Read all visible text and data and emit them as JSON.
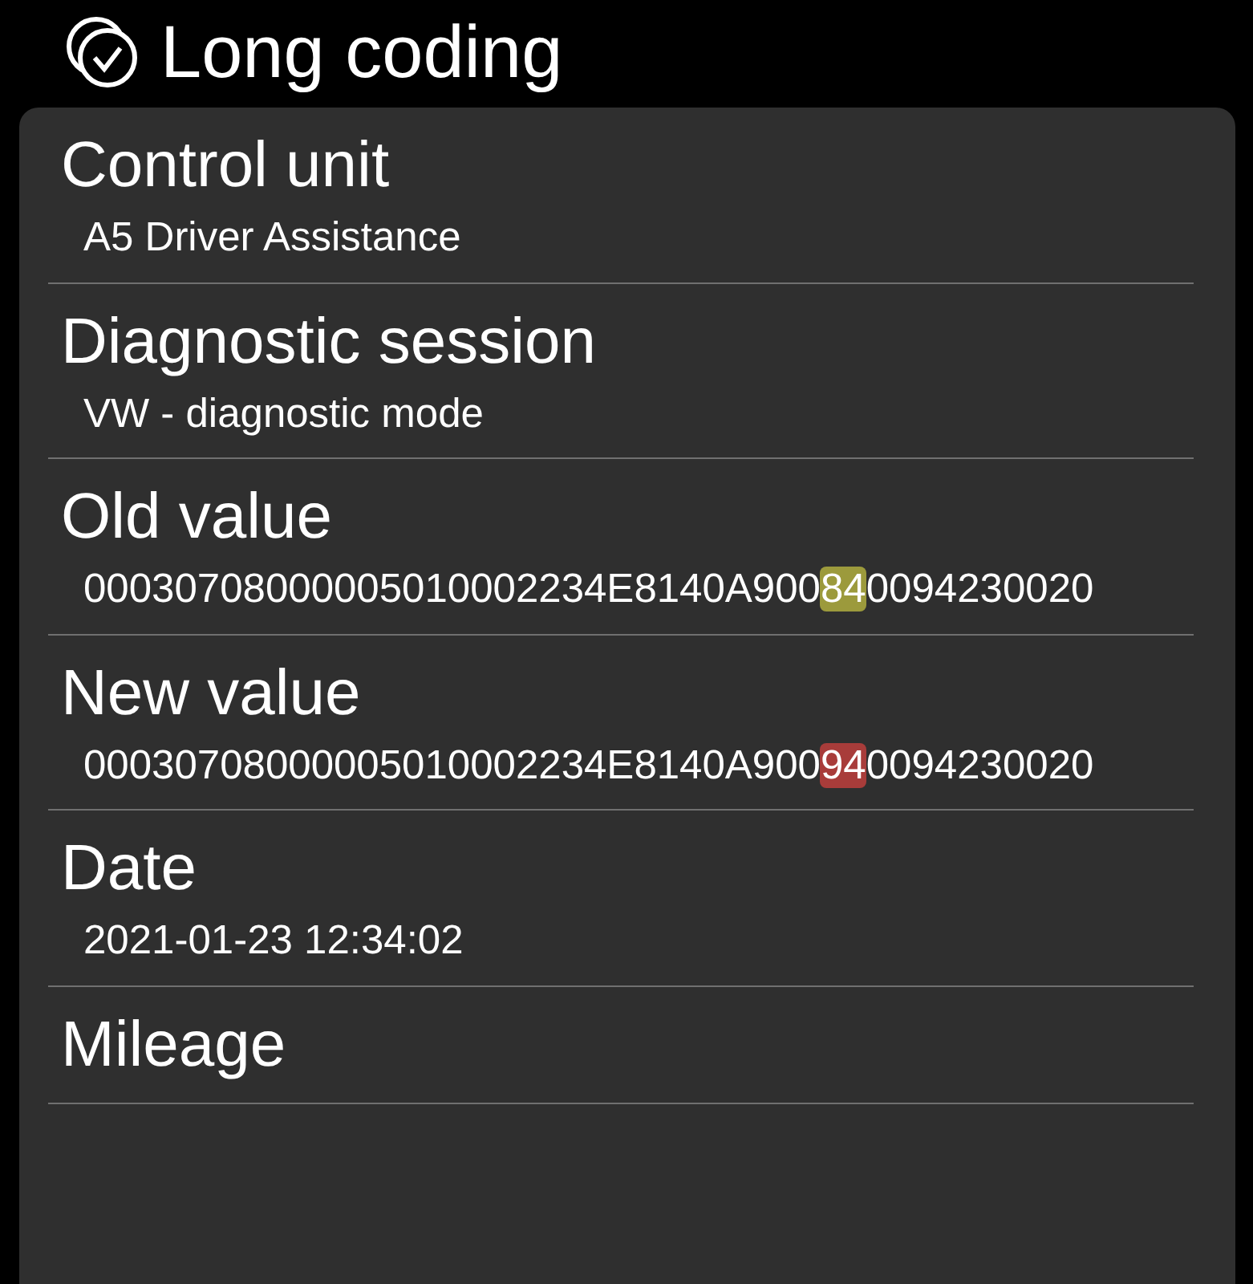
{
  "header": {
    "title": "Long coding"
  },
  "rows": [
    {
      "label": "Control unit",
      "value": [
        {
          "text": "A5 Driver Assistance"
        }
      ]
    },
    {
      "label": "Diagnostic session",
      "value": [
        {
          "text": "VW - diagnostic mode"
        }
      ]
    },
    {
      "label": "Old value",
      "value": [
        {
          "text": "00030708000005010002234E8140A900"
        },
        {
          "text": "84",
          "color": "#9c9a3c"
        },
        {
          "text": "0094230020"
        }
      ]
    },
    {
      "label": "New value",
      "value": [
        {
          "text": "00030708000005010002234E8140A900"
        },
        {
          "text": "94",
          "color": "#a83c3a"
        },
        {
          "text": "0094230020"
        }
      ]
    },
    {
      "label": "Date",
      "value": [
        {
          "text": "2021-01-23 12:34:02"
        }
      ]
    },
    {
      "label": "Mileage"
    }
  ]
}
